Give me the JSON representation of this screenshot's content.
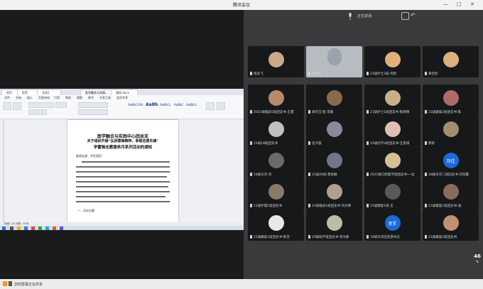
{
  "window": {
    "title": "腾讯会议",
    "minimize_glyph": "—",
    "maximize_glyph": "□",
    "close_glyph": "✕"
  },
  "toolbar": {
    "status_text": "正在讲话:"
  },
  "document": {
    "tabs": [
      "首页",
      "稻壳",
      "文档1",
      "医学融合与实践...",
      "通知.docx"
    ],
    "menu": [
      "文件",
      "开始",
      "插入",
      "页面布局",
      "引用",
      "审阅",
      "视图",
      "章节",
      "开发工具",
      "会员专享"
    ],
    "styles": [
      "AaBbCcDd",
      "AaBb",
      "AaBbCc",
      "AaBbC",
      "AaBbCc"
    ],
    "title_line1": "医学融合与实践中心团总支",
    "title_line2": "关于组织开展“弘扬雷锋精神，争做志愿先锋”",
    "title_line3": "学雷锋志愿服务月系列活动的通知",
    "salutation": "各团支部、学生团员：",
    "list_item": "一、活动主题",
    "status": "页面: 1/3   字数: 1528"
  },
  "participants": [
    {
      "name": "阳双飞",
      "color": "#c9a98a"
    },
    {
      "name": "邵向东",
      "color": "#9aa3ad",
      "video": true
    },
    {
      "name": "21级护士3班-何凯",
      "color": "#e0b07a"
    },
    {
      "name": "黄佳欣",
      "color": "#d8b27a"
    },
    {
      "name": "2021级临床5班团支书-王慧",
      "color": "#b88a6a"
    },
    {
      "name": "胡可玉-医-李嘉",
      "color": "#8a6a4a"
    },
    {
      "name": "21级护士1班团支书-陈晓晴",
      "color": "#c8b08a"
    },
    {
      "name": "21级康复2班团支书-陈",
      "color": "#b06a6a"
    },
    {
      "name": "21级18班团支书",
      "color": "#c0c0c0"
    },
    {
      "name": "伍子晨",
      "color": "#8a8a9a"
    },
    {
      "name": "22级药学4班团支书-王思琪",
      "color": "#e0c0b0"
    },
    {
      "name": "熊新",
      "color": "#a09070"
    },
    {
      "name": "18级天华-刘",
      "color": "#6a6a6a"
    },
    {
      "name": "21级20班-蔡思敏",
      "color": "#707888"
    },
    {
      "name": "2022级口腔医学班团支书-一位",
      "color": "#d4c090"
    },
    {
      "name": "18级天华二班团支书-刘佳鑫",
      "text": "刘佳",
      "color": "#1a6bd6"
    },
    {
      "name": "21级护理1班团支书",
      "color": "#8a7a6a"
    },
    {
      "name": "21级临床1班团支书-刘文婷",
      "color": "#b0a090"
    },
    {
      "name": "21级康复1班-王",
      "color": "#5a5a5a"
    },
    {
      "name": "21级康复1班团支书-张",
      "color": "#8a6a5a"
    },
    {
      "name": "21级康复1班团支书-陈佳",
      "color": "#e8e8e8"
    },
    {
      "name": "20级助产班团支书-李文静",
      "color": "#b8c0a0"
    },
    {
      "name": "19级天华团支部书记",
      "text": "思军",
      "color": "#1a6bd6"
    },
    {
      "name": "21级康复2班团支书",
      "color": "#c09070"
    }
  ],
  "side_indicator": {
    "value": "46",
    "unit": "%"
  },
  "bottom_bar": {
    "text": "您的屏幕正在共享"
  }
}
